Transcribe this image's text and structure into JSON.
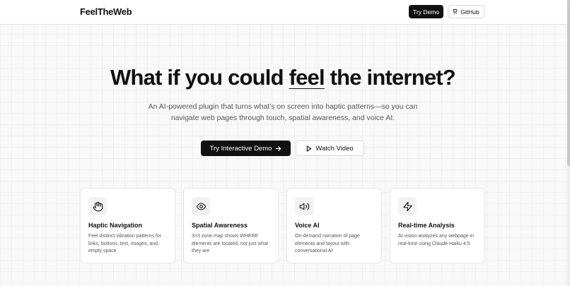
{
  "header": {
    "brand": "FeelTheWeb",
    "try_demo_label": "Try Demo",
    "github_label": "GitHub"
  },
  "hero": {
    "title_before": "What if you could ",
    "title_emphasis": "feel",
    "title_after": " the internet?",
    "subtitle_line1": "An AI-powered plugin that turns what's on screen into haptic patterns—so you can",
    "subtitle_line2": "navigate web pages through touch, spatial awareness, and voice AI.",
    "primary_cta": "Try Interactive Demo",
    "secondary_cta": "Watch Video"
  },
  "features": [
    {
      "icon": "hand-icon",
      "title": "Haptic Navigation",
      "description": "Feel distinct vibration patterns for links, buttons, text, images, and empty space"
    },
    {
      "icon": "eye-icon",
      "title": "Spatial Awareness",
      "description": "3×3 zone map shows WHERE elements are located, not just what they are"
    },
    {
      "icon": "speaker-icon",
      "title": "Voice AI",
      "description": "On-demand narration of page elements and layout with conversational AI"
    },
    {
      "icon": "lightning-icon",
      "title": "Real-time Analysis",
      "description": "AI vision analyzes any webpage in real-time using Claude Haiku 4.5"
    }
  ],
  "colors": {
    "primary": "#111111",
    "background": "#f9f9f9",
    "muted_text": "#555555"
  }
}
